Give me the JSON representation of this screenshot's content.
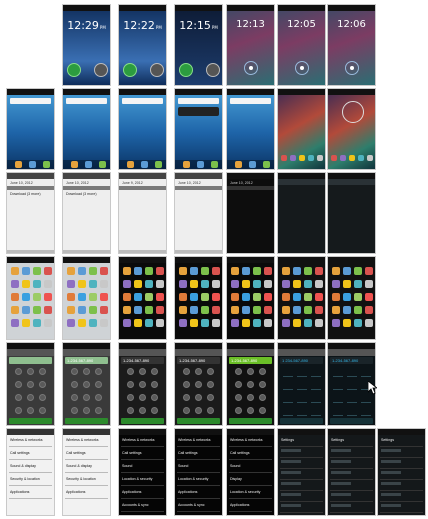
{
  "rows": [
    {
      "type": "lock",
      "shots": [
        {
          "style": "blank"
        },
        {
          "style": "lock-gb",
          "time": "12:29",
          "ampm": "PM"
        },
        {
          "style": "lock-gb",
          "time": "12:22",
          "ampm": "PM"
        },
        {
          "style": "lock-gb-dark",
          "time": "12:15",
          "ampm": "PM"
        },
        {
          "style": "lock-ics",
          "time": "12:13",
          "ampm": ""
        },
        {
          "style": "lock-ics",
          "time": "12:05",
          "ampm": ""
        },
        {
          "style": "lock-ics",
          "time": "12:06",
          "ampm": ""
        }
      ]
    },
    {
      "type": "home",
      "shots": [
        {
          "style": "home-blue"
        },
        {
          "style": "home-blue"
        },
        {
          "style": "home-blue"
        },
        {
          "style": "home-blue-widget"
        },
        {
          "style": "home-blue"
        },
        {
          "style": "home-ics"
        },
        {
          "style": "home-ics-clock"
        }
      ]
    },
    {
      "type": "notif",
      "shots": [
        {
          "style": "notif-light",
          "date": "June 10, 2012",
          "item": "Download (3 more)"
        },
        {
          "style": "notif-light",
          "date": "June 10, 2012",
          "item": "Download (3 more)"
        },
        {
          "style": "notif-light",
          "date": "June 9, 2012",
          "item": ""
        },
        {
          "style": "notif-light",
          "date": "June 10, 2012",
          "item": ""
        },
        {
          "style": "notif-dark",
          "date": "June 10, 2012",
          "item": ""
        },
        {
          "style": "notif-ics"
        },
        {
          "style": "notif-ics"
        }
      ]
    },
    {
      "type": "drawer",
      "shots": [
        {
          "style": "drawer-light"
        },
        {
          "style": "drawer-light"
        },
        {
          "style": "drawer-dark"
        },
        {
          "style": "drawer-dark"
        },
        {
          "style": "drawer-dark"
        },
        {
          "style": "drawer-ics"
        },
        {
          "style": "drawer-ics"
        }
      ]
    },
    {
      "type": "dialer",
      "shots": [
        {
          "style": "dialer-gray",
          "number": ""
        },
        {
          "style": "dialer-gray",
          "number": "1-234-567-890"
        },
        {
          "style": "dialer-dark",
          "number": "1-234-567-890"
        },
        {
          "style": "dialer-dark",
          "number": "1-234-567-890"
        },
        {
          "style": "dialer-green",
          "number": "1-234-567-890"
        },
        {
          "style": "dialer-ics",
          "number": "1 234-567-890"
        },
        {
          "style": "dialer-ics",
          "number": "1-234-567-890"
        }
      ]
    },
    {
      "type": "settings",
      "shots": [
        {
          "style": "settings-light",
          "items": [
            "Wireless & networks",
            "Call settings",
            "Sound & display",
            "Security & location",
            "Applications"
          ]
        },
        {
          "style": "settings-light",
          "items": [
            "Wireless & networks",
            "Call settings",
            "Sound & display",
            "Security & location",
            "Applications"
          ]
        },
        {
          "style": "settings-dark",
          "items": [
            "Wireless & networks",
            "Call settings",
            "Sound",
            "Location & security",
            "Applications",
            "Accounts & sync"
          ]
        },
        {
          "style": "settings-dark",
          "items": [
            "Wireless & networks",
            "Call settings",
            "Sound",
            "Location & security",
            "Applications",
            "Accounts & sync"
          ]
        },
        {
          "style": "settings-dark",
          "items": [
            "Wireless & networks",
            "Call settings",
            "Sound",
            "Display",
            "Location & security",
            "Applications",
            "Accounts & sync"
          ]
        },
        {
          "style": "settings-ics",
          "items": [
            "Settings",
            "",
            "",
            "",
            "",
            "",
            ""
          ]
        },
        {
          "style": "settings-ics",
          "items": [
            "Settings",
            "",
            "",
            "",
            "",
            "",
            ""
          ]
        },
        {
          "style": "settings-ics",
          "items": [
            "Settings",
            "",
            "",
            "",
            "",
            "",
            ""
          ]
        }
      ]
    }
  ],
  "colors": {
    "gb_blue": "#2f5fa8",
    "ics_bg": "#1a2a2e",
    "green": "#6bbf27",
    "ics_blue": "#33b5e5"
  }
}
